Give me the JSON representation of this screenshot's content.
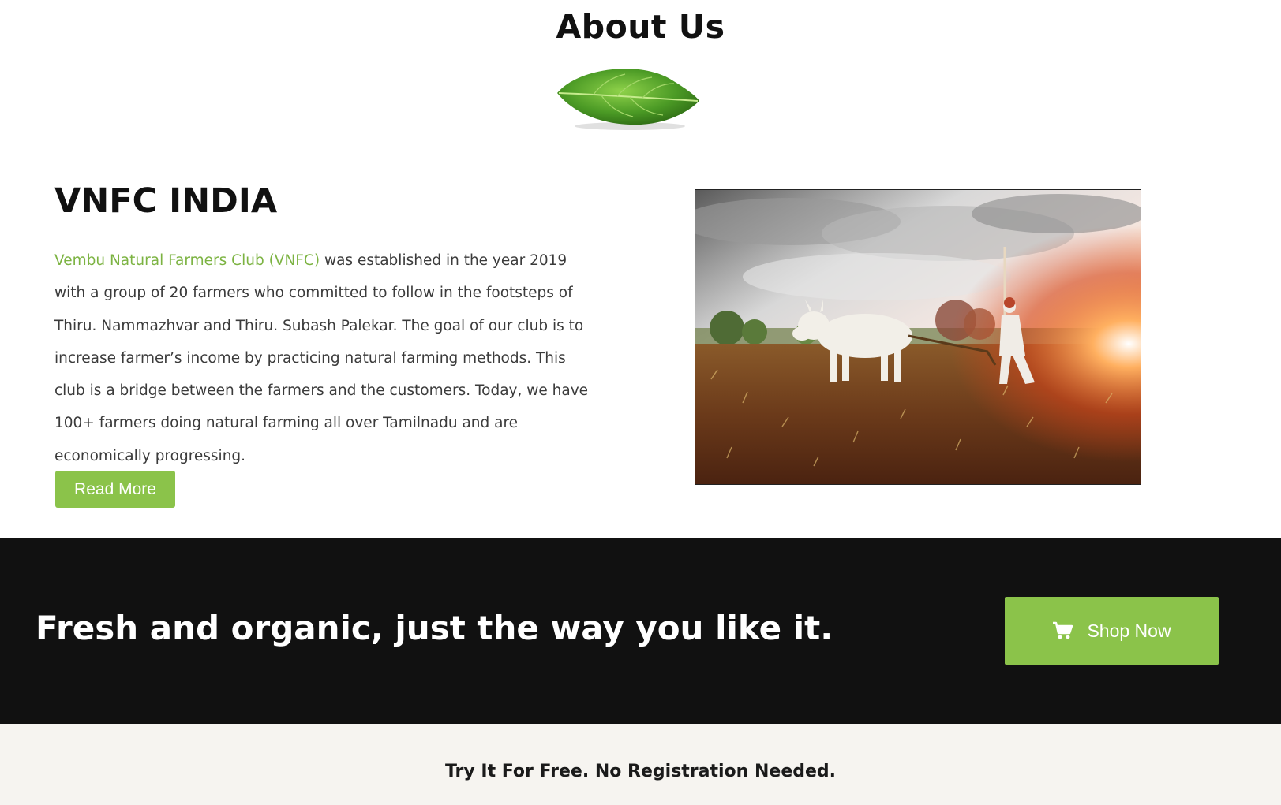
{
  "about": {
    "title": "About Us",
    "leaf_icon": "leaf-icon"
  },
  "intro": {
    "heading": "VNFC INDIA",
    "link_text": "Vembu Natural Farmers Club (VNFC)",
    "body_text": " was established in the year 2019 with a group of 20 farmers who committed to follow in the footsteps of Thiru. Nammazhvar and Thiru. Subash Palekar. The goal of our club is to increase farmer’s income by practicing natural farming methods. This club is a bridge between the farmers and the customers. Today, we have 100+ farmers doing natural farming all over Tamilnadu and are economically progressing.",
    "read_more_label": "Read More"
  },
  "promo": {
    "tagline": "Fresh and organic, just the way you like it.",
    "shop_now_label": "Shop Now",
    "cart_icon": "cart-icon"
  },
  "free_band": {
    "text": "Try It For Free. No Registration Needed."
  },
  "colors": {
    "accent": "#8bc34a",
    "link": "#7cb342",
    "dark_band": "#111111",
    "light_band": "#f6f4f0",
    "text": "#3b3b3b"
  }
}
